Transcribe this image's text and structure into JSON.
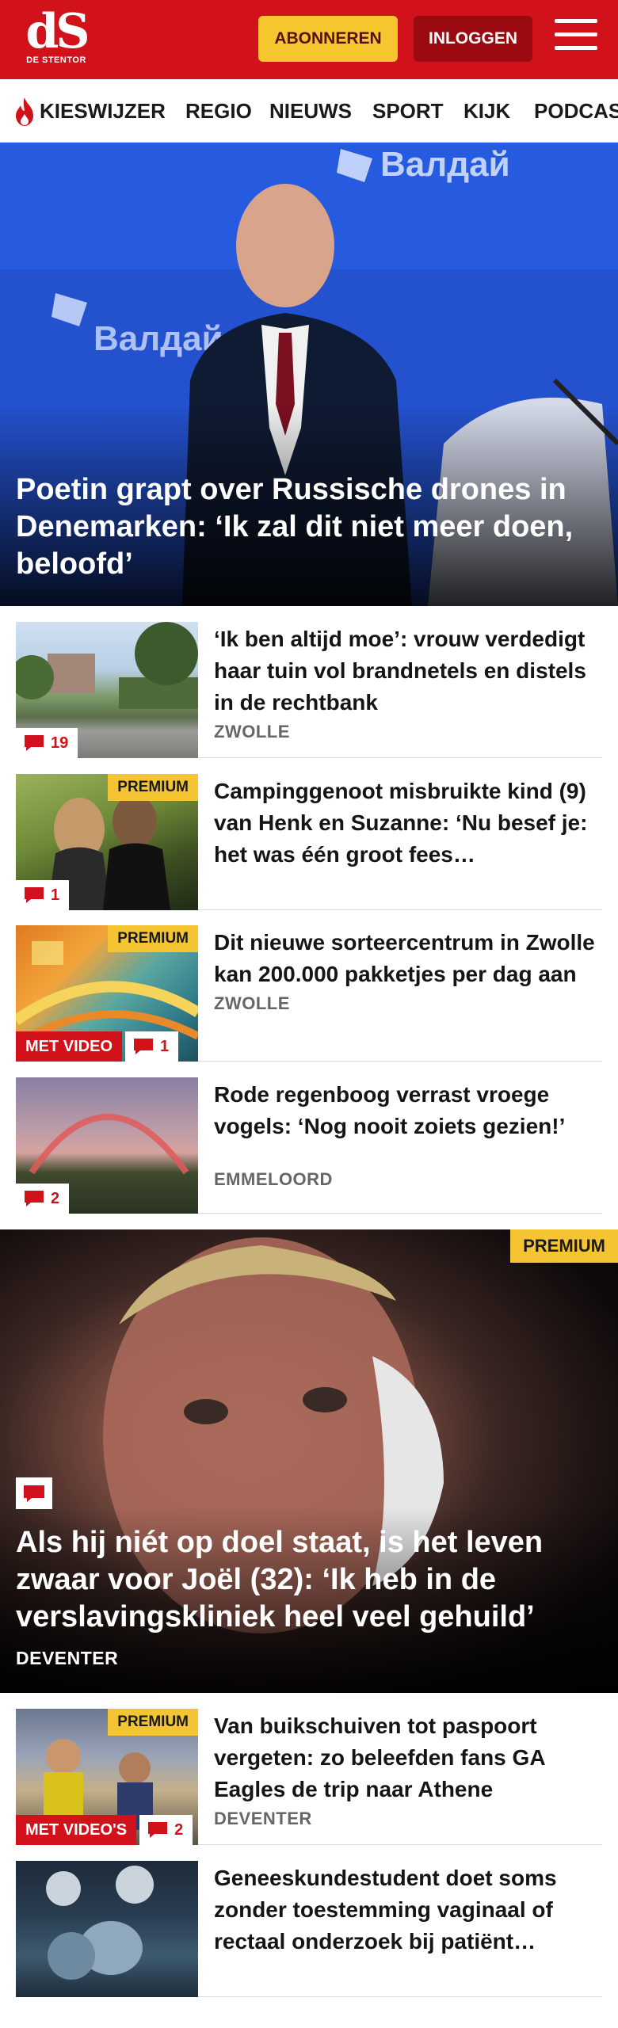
{
  "header": {
    "logo_mark": "dS",
    "logo_sub": "DE STENTOR",
    "subscribe_label": "ABONNEREN",
    "login_label": "INLOGGEN",
    "brand_color": "#d2121a",
    "subscribe_color": "#f7c52d"
  },
  "nav": {
    "items": [
      {
        "label": "KIESWIJZER",
        "icon": "flame-icon"
      },
      {
        "label": "REGIO"
      },
      {
        "label": "NIEUWS"
      },
      {
        "label": "SPORT"
      },
      {
        "label": "KIJK"
      },
      {
        "label": "PODCAS"
      }
    ]
  },
  "hero": {
    "title": "Poetin grapt over Russische drones in Denemarken: ‘Ik zal dit niet meer doen, beloofd’",
    "image_text": "Валдай"
  },
  "articles": [
    {
      "title": "‘Ik ben altijd moe’: vrouw verdedigt haar tuin vol brandne­tels en distels in de rechtbank",
      "region": "ZWOLLE",
      "comments": "19",
      "premium": "",
      "video": ""
    },
    {
      "title": "Campinggenoot misbruikte kind (9) van Henk en Suzanne: ‘Nu besef je: het was één groot fees…",
      "region": "",
      "comments": "1",
      "premium": "PREMIUM",
      "video": ""
    },
    {
      "title": "Dit nieuwe sorteercentrum in Zwolle kan 200.000 pakketjes per dag aan",
      "region": "ZWOLLE",
      "comments": "1",
      "premium": "PREMIUM",
      "video": "MET VIDEO"
    },
    {
      "title": "Rode regenboog verrast vroege vogels: ‘Nog nooit zoiets gezien!’",
      "region": "EMMELOORD",
      "comments": "2",
      "premium": "",
      "video": ""
    }
  ],
  "feature": {
    "premium": "PREMIUM",
    "title": "Als hij niét op doel staat, is het leven zwaar voor Joël (32): ‘Ik heb in de verslavingskliniek heel veel gehuild’",
    "region": "DEVENTER"
  },
  "articles2": [
    {
      "title": "Van buikschuiven tot paspoort vergeten: zo beleefden fans GA Eagles de trip naar Athene",
      "region": "DEVENTER",
      "comments": "2",
      "premium": "PREMIUM",
      "video": "MET VIDEO'S"
    },
    {
      "title": "Geneeskundestudent doet soms zonder toestemming vaginaal of rectaal onderzoek bij patiënt…",
      "region": "",
      "comments": "",
      "premium": "",
      "video": ""
    }
  ]
}
